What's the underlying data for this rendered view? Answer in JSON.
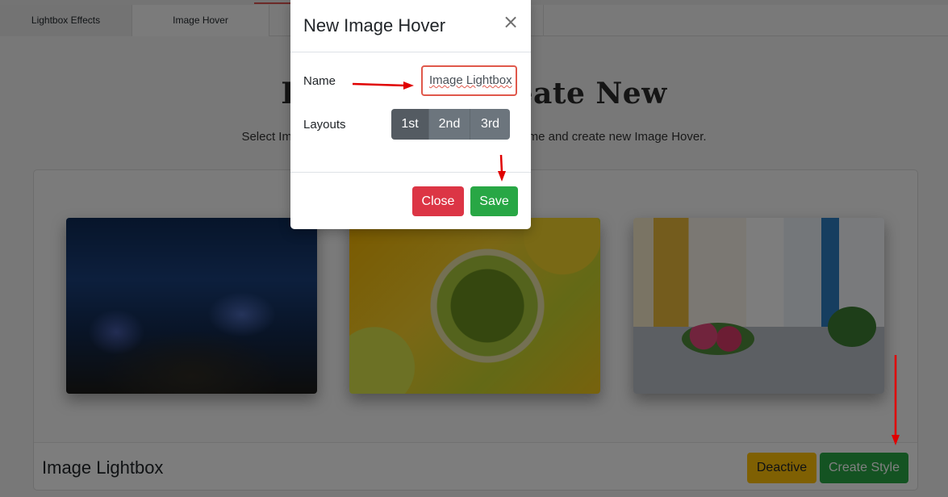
{
  "tabs": [
    {
      "label": "Lightbox Effects"
    },
    {
      "label": "Image Hover"
    },
    {
      "label": ""
    }
  ],
  "page": {
    "heading": "Lightbox & Create New",
    "subtext": "Select Image Hover Style, Give your Image Hover Name and create new Image Hover."
  },
  "panel": {
    "title": "Image Lightbox",
    "deactive_label": "Deactive",
    "create_label": "Create Style"
  },
  "modal": {
    "title": "New Image Hover",
    "close_icon": "×",
    "name_label": "Name",
    "name_value": "Image Lightbox",
    "layouts_label": "Layouts",
    "layouts": [
      "1st",
      "2nd",
      "3rd"
    ],
    "selected_layout": "1st",
    "close_label": "Close",
    "save_label": "Save"
  },
  "colors": {
    "save": "#28a745",
    "close": "#dc3545",
    "deactive": "#ffc107",
    "annotation_arrow": "#e00000"
  }
}
